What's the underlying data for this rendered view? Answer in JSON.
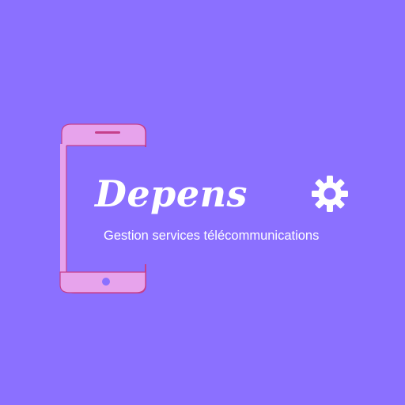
{
  "brand": {
    "name": "Depens",
    "tagline": "Gestion services télécommunications"
  },
  "colors": {
    "background": "#8b70ff",
    "phone_fill": "#e7a3ec",
    "phone_outline": "#c53f8b",
    "text": "#ffffff"
  },
  "icons": {
    "phone": "smartphone-icon",
    "gear": "gear-icon"
  }
}
